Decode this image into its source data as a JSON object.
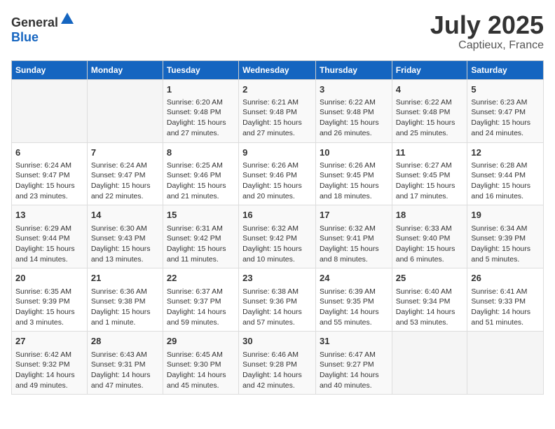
{
  "header": {
    "logo_general": "General",
    "logo_blue": "Blue",
    "month": "July 2025",
    "location": "Captieux, France"
  },
  "weekdays": [
    "Sunday",
    "Monday",
    "Tuesday",
    "Wednesday",
    "Thursday",
    "Friday",
    "Saturday"
  ],
  "weeks": [
    [
      {
        "day": "",
        "info": ""
      },
      {
        "day": "",
        "info": ""
      },
      {
        "day": "1",
        "info": "Sunrise: 6:20 AM\nSunset: 9:48 PM\nDaylight: 15 hours\nand 27 minutes."
      },
      {
        "day": "2",
        "info": "Sunrise: 6:21 AM\nSunset: 9:48 PM\nDaylight: 15 hours\nand 27 minutes."
      },
      {
        "day": "3",
        "info": "Sunrise: 6:22 AM\nSunset: 9:48 PM\nDaylight: 15 hours\nand 26 minutes."
      },
      {
        "day": "4",
        "info": "Sunrise: 6:22 AM\nSunset: 9:48 PM\nDaylight: 15 hours\nand 25 minutes."
      },
      {
        "day": "5",
        "info": "Sunrise: 6:23 AM\nSunset: 9:47 PM\nDaylight: 15 hours\nand 24 minutes."
      }
    ],
    [
      {
        "day": "6",
        "info": "Sunrise: 6:24 AM\nSunset: 9:47 PM\nDaylight: 15 hours\nand 23 minutes."
      },
      {
        "day": "7",
        "info": "Sunrise: 6:24 AM\nSunset: 9:47 PM\nDaylight: 15 hours\nand 22 minutes."
      },
      {
        "day": "8",
        "info": "Sunrise: 6:25 AM\nSunset: 9:46 PM\nDaylight: 15 hours\nand 21 minutes."
      },
      {
        "day": "9",
        "info": "Sunrise: 6:26 AM\nSunset: 9:46 PM\nDaylight: 15 hours\nand 20 minutes."
      },
      {
        "day": "10",
        "info": "Sunrise: 6:26 AM\nSunset: 9:45 PM\nDaylight: 15 hours\nand 18 minutes."
      },
      {
        "day": "11",
        "info": "Sunrise: 6:27 AM\nSunset: 9:45 PM\nDaylight: 15 hours\nand 17 minutes."
      },
      {
        "day": "12",
        "info": "Sunrise: 6:28 AM\nSunset: 9:44 PM\nDaylight: 15 hours\nand 16 minutes."
      }
    ],
    [
      {
        "day": "13",
        "info": "Sunrise: 6:29 AM\nSunset: 9:44 PM\nDaylight: 15 hours\nand 14 minutes."
      },
      {
        "day": "14",
        "info": "Sunrise: 6:30 AM\nSunset: 9:43 PM\nDaylight: 15 hours\nand 13 minutes."
      },
      {
        "day": "15",
        "info": "Sunrise: 6:31 AM\nSunset: 9:42 PM\nDaylight: 15 hours\nand 11 minutes."
      },
      {
        "day": "16",
        "info": "Sunrise: 6:32 AM\nSunset: 9:42 PM\nDaylight: 15 hours\nand 10 minutes."
      },
      {
        "day": "17",
        "info": "Sunrise: 6:32 AM\nSunset: 9:41 PM\nDaylight: 15 hours\nand 8 minutes."
      },
      {
        "day": "18",
        "info": "Sunrise: 6:33 AM\nSunset: 9:40 PM\nDaylight: 15 hours\nand 6 minutes."
      },
      {
        "day": "19",
        "info": "Sunrise: 6:34 AM\nSunset: 9:39 PM\nDaylight: 15 hours\nand 5 minutes."
      }
    ],
    [
      {
        "day": "20",
        "info": "Sunrise: 6:35 AM\nSunset: 9:39 PM\nDaylight: 15 hours\nand 3 minutes."
      },
      {
        "day": "21",
        "info": "Sunrise: 6:36 AM\nSunset: 9:38 PM\nDaylight: 15 hours\nand 1 minute."
      },
      {
        "day": "22",
        "info": "Sunrise: 6:37 AM\nSunset: 9:37 PM\nDaylight: 14 hours\nand 59 minutes."
      },
      {
        "day": "23",
        "info": "Sunrise: 6:38 AM\nSunset: 9:36 PM\nDaylight: 14 hours\nand 57 minutes."
      },
      {
        "day": "24",
        "info": "Sunrise: 6:39 AM\nSunset: 9:35 PM\nDaylight: 14 hours\nand 55 minutes."
      },
      {
        "day": "25",
        "info": "Sunrise: 6:40 AM\nSunset: 9:34 PM\nDaylight: 14 hours\nand 53 minutes."
      },
      {
        "day": "26",
        "info": "Sunrise: 6:41 AM\nSunset: 9:33 PM\nDaylight: 14 hours\nand 51 minutes."
      }
    ],
    [
      {
        "day": "27",
        "info": "Sunrise: 6:42 AM\nSunset: 9:32 PM\nDaylight: 14 hours\nand 49 minutes."
      },
      {
        "day": "28",
        "info": "Sunrise: 6:43 AM\nSunset: 9:31 PM\nDaylight: 14 hours\nand 47 minutes."
      },
      {
        "day": "29",
        "info": "Sunrise: 6:45 AM\nSunset: 9:30 PM\nDaylight: 14 hours\nand 45 minutes."
      },
      {
        "day": "30",
        "info": "Sunrise: 6:46 AM\nSunset: 9:28 PM\nDaylight: 14 hours\nand 42 minutes."
      },
      {
        "day": "31",
        "info": "Sunrise: 6:47 AM\nSunset: 9:27 PM\nDaylight: 14 hours\nand 40 minutes."
      },
      {
        "day": "",
        "info": ""
      },
      {
        "day": "",
        "info": ""
      }
    ]
  ]
}
